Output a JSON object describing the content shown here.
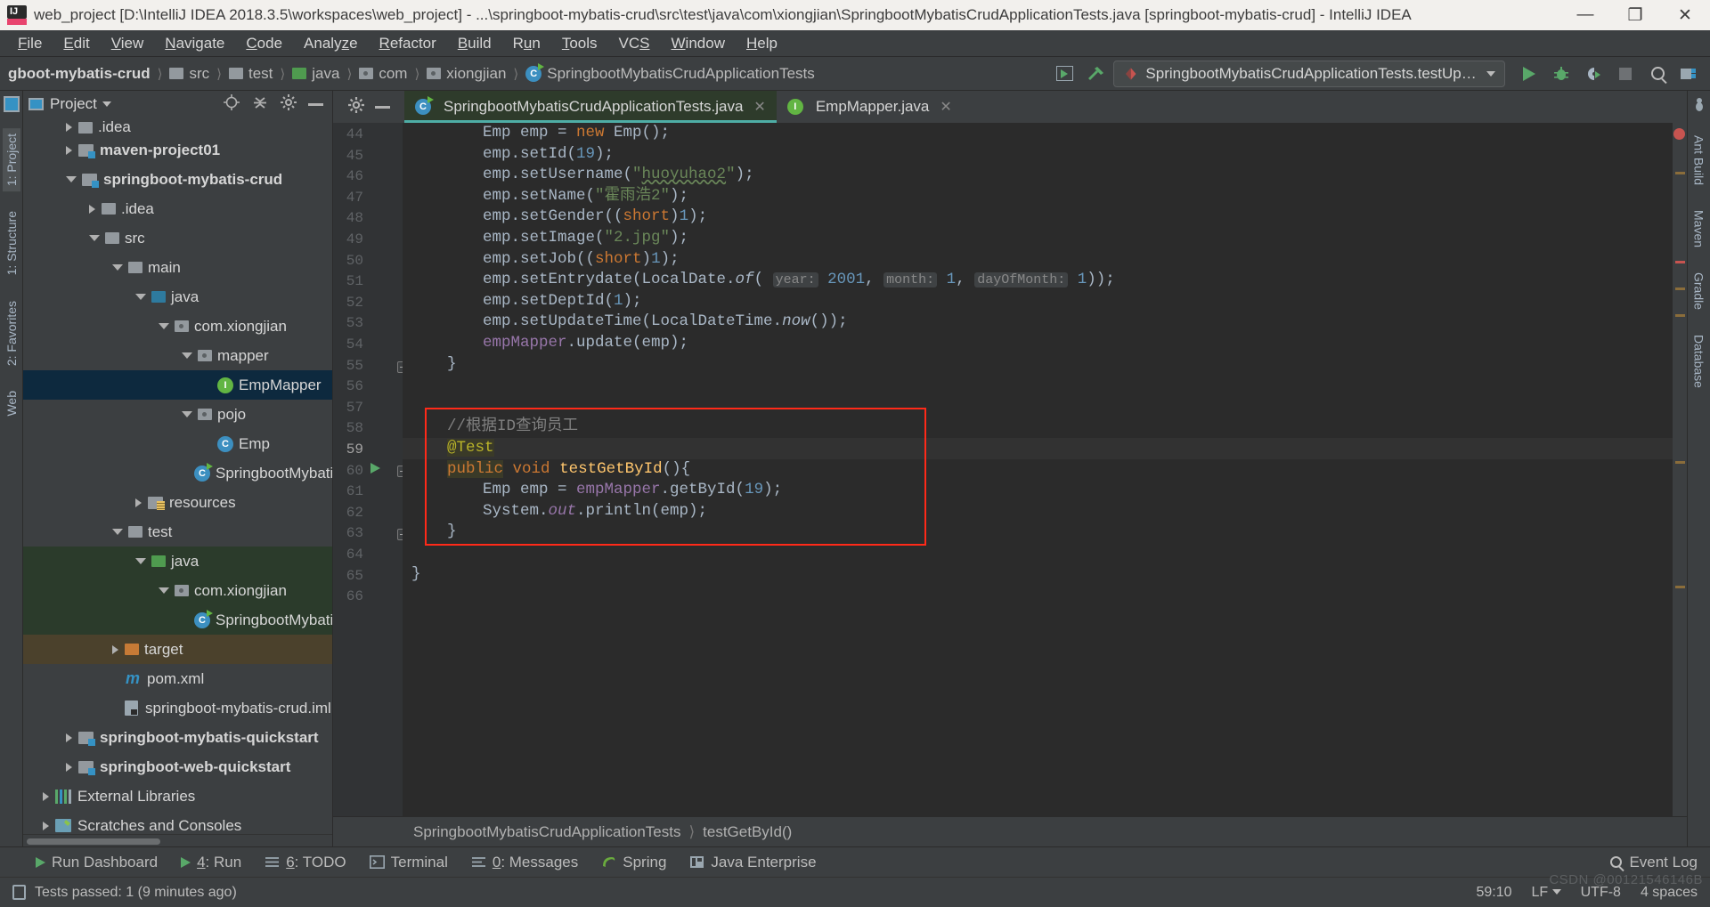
{
  "window": {
    "title": "web_project [D:\\IntelliJ IDEA 2018.3.5\\workspaces\\web_project] - ...\\springboot-mybatis-crud\\src\\test\\java\\com\\xiongjian\\SpringbootMybatisCrudApplicationTests.java [springboot-mybatis-crud] - IntelliJ IDEA",
    "minimize": "—",
    "maximize": "❐",
    "close": "✕"
  },
  "menubar": [
    {
      "label": "File",
      "mnemonic": "F"
    },
    {
      "label": "Edit",
      "mnemonic": "E"
    },
    {
      "label": "View",
      "mnemonic": "V"
    },
    {
      "label": "Navigate",
      "mnemonic": "N"
    },
    {
      "label": "Code",
      "mnemonic": "C"
    },
    {
      "label": "Analyze",
      "mnemonic": "z"
    },
    {
      "label": "Refactor",
      "mnemonic": "R"
    },
    {
      "label": "Build",
      "mnemonic": "B"
    },
    {
      "label": "Run",
      "mnemonic": "u"
    },
    {
      "label": "Tools",
      "mnemonic": "T"
    },
    {
      "label": "VCS",
      "mnemonic": "S"
    },
    {
      "label": "Window",
      "mnemonic": "W"
    },
    {
      "label": "Help",
      "mnemonic": "H"
    }
  ],
  "navbar": {
    "crumbs": [
      {
        "label": "gboot-mybatis-crud",
        "icon": "module-icon"
      },
      {
        "label": "src",
        "icon": "folder-icon"
      },
      {
        "label": "test",
        "icon": "folder-icon"
      },
      {
        "label": "java",
        "icon": "source-folder-icon"
      },
      {
        "label": "com",
        "icon": "package-icon"
      },
      {
        "label": "xiongjian",
        "icon": "package-icon"
      },
      {
        "label": "SpringbootMybatisCrudApplicationTests",
        "icon": "test-class-icon"
      }
    ],
    "run_config": "SpringbootMybatisCrudApplicationTests.testUpdate"
  },
  "project_panel": {
    "title": "Project",
    "tree": [
      {
        "label": ".idea",
        "indent": 1,
        "toggle": "collapsed",
        "icon": "folder-icon",
        "bold": false,
        "state": "clipped"
      },
      {
        "label": "maven-project01",
        "indent": 1,
        "toggle": "collapsed",
        "icon": "module-icon",
        "bold": true
      },
      {
        "label": "springboot-mybatis-crud",
        "indent": 1,
        "toggle": "expanded",
        "icon": "module-icon",
        "bold": true
      },
      {
        "label": ".idea",
        "indent": 2,
        "toggle": "collapsed",
        "icon": "folder-icon",
        "bold": false
      },
      {
        "label": "src",
        "indent": 2,
        "toggle": "expanded",
        "icon": "folder-icon",
        "bold": false
      },
      {
        "label": "main",
        "indent": 3,
        "toggle": "expanded",
        "icon": "folder-icon",
        "bold": false
      },
      {
        "label": "java",
        "indent": 4,
        "toggle": "expanded",
        "icon": "source-folder-icon",
        "bold": false
      },
      {
        "label": "com.xiongjian",
        "indent": 5,
        "toggle": "expanded",
        "icon": "package-icon",
        "bold": false
      },
      {
        "label": "mapper",
        "indent": 6,
        "toggle": "expanded",
        "icon": "package-icon",
        "bold": false
      },
      {
        "label": "EmpMapper",
        "indent": 7,
        "toggle": "none",
        "icon": "interface-icon",
        "bold": false,
        "selected": true
      },
      {
        "label": "pojo",
        "indent": 6,
        "toggle": "expanded",
        "icon": "package-icon",
        "bold": false
      },
      {
        "label": "Emp",
        "indent": 7,
        "toggle": "none",
        "icon": "class-icon",
        "bold": false
      },
      {
        "label": "SpringbootMybatisCruc",
        "indent": 6,
        "toggle": "none",
        "icon": "spring-class-icon",
        "bold": false
      },
      {
        "label": "resources",
        "indent": 4,
        "toggle": "collapsed",
        "icon": "resources-folder-icon",
        "bold": false
      },
      {
        "label": "test",
        "indent": 3,
        "toggle": "expanded",
        "icon": "folder-icon",
        "bold": false
      },
      {
        "label": "java",
        "indent": 4,
        "toggle": "expanded",
        "icon": "test-source-folder-icon",
        "bold": false,
        "row_bg": "test"
      },
      {
        "label": "com.xiongjian",
        "indent": 5,
        "toggle": "expanded",
        "icon": "package-icon",
        "bold": false,
        "row_bg": "test"
      },
      {
        "label": "SpringbootMybatisCruc",
        "indent": 6,
        "toggle": "none",
        "icon": "spring-class-icon",
        "bold": false,
        "row_bg": "test"
      },
      {
        "label": "target",
        "indent": 3,
        "toggle": "collapsed",
        "icon": "excluded-folder-icon",
        "bold": false,
        "row_bg": "target"
      },
      {
        "label": "pom.xml",
        "indent": 3,
        "toggle": "none",
        "icon": "maven-icon",
        "bold": false
      },
      {
        "label": "springboot-mybatis-crud.iml",
        "indent": 3,
        "toggle": "none",
        "icon": "iml-icon",
        "bold": false
      },
      {
        "label": "springboot-mybatis-quickstart",
        "indent": 1,
        "toggle": "collapsed",
        "icon": "module-icon",
        "bold": true
      },
      {
        "label": "springboot-web-quickstart",
        "indent": 1,
        "toggle": "collapsed",
        "icon": "module-icon",
        "bold": true
      },
      {
        "label": "External Libraries",
        "indent": 0,
        "toggle": "collapsed",
        "icon": "libraries-icon",
        "bold": false
      },
      {
        "label": "Scratches and Consoles",
        "indent": 0,
        "toggle": "collapsed",
        "icon": "scratches-icon",
        "bold": false
      }
    ]
  },
  "left_strip": [
    {
      "label": "1: Project",
      "selected": true
    },
    {
      "label": "1: Structure",
      "selected": false
    },
    {
      "label": "2: Favorites",
      "selected": false
    },
    {
      "label": "Web",
      "selected": false
    }
  ],
  "right_strip": [
    {
      "label": "Ant Build"
    },
    {
      "label": "Maven"
    },
    {
      "label": "Gradle"
    },
    {
      "label": "Database"
    }
  ],
  "editor": {
    "tabs": [
      {
        "label": "SpringbootMybatisCrudApplicationTests.java",
        "icon": "spring-test-class-icon",
        "active": true
      },
      {
        "label": "EmpMapper.java",
        "icon": "interface-icon",
        "active": false
      }
    ],
    "first_line_number": 44,
    "lines": [
      {
        "n": 44,
        "text": "        Emp emp = new Emp();"
      },
      {
        "n": 45,
        "text": "        emp.setId(19);"
      },
      {
        "n": 46,
        "text": "        emp.setUsername(\"huoyuhao2\");"
      },
      {
        "n": 47,
        "text": "        emp.setName(\"霍雨浩2\");"
      },
      {
        "n": 48,
        "text": "        emp.setGender((short)1);"
      },
      {
        "n": 49,
        "text": "        emp.setImage(\"2.jpg\");"
      },
      {
        "n": 50,
        "text": "        emp.setJob((short)1);"
      },
      {
        "n": 51,
        "text": "        emp.setEntrydate(LocalDate.of( year: 2001, month: 1, dayOfMonth: 1));"
      },
      {
        "n": 52,
        "text": "        emp.setDeptId(1);"
      },
      {
        "n": 53,
        "text": "        emp.setUpdateTime(LocalDateTime.now());"
      },
      {
        "n": 54,
        "text": "        empMapper.update(emp);"
      },
      {
        "n": 55,
        "text": "    }"
      },
      {
        "n": 56,
        "text": ""
      },
      {
        "n": 57,
        "text": ""
      },
      {
        "n": 58,
        "text": "    //根据ID查询员工"
      },
      {
        "n": 59,
        "text": "    @Test"
      },
      {
        "n": 60,
        "text": "    public void testGetById(){"
      },
      {
        "n": 61,
        "text": "        Emp emp = empMapper.getById(19);"
      },
      {
        "n": 62,
        "text": "        System.out.println(emp);"
      },
      {
        "n": 63,
        "text": "    }"
      },
      {
        "n": 64,
        "text": ""
      },
      {
        "n": 65,
        "text": "}"
      },
      {
        "n": 66,
        "text": ""
      }
    ],
    "breadcrumb": {
      "class": "SpringbootMybatisCrudApplicationTests",
      "method": "testGetById()"
    },
    "highlight_box_label": "red-annotation-box"
  },
  "bottom_toolwindows": [
    {
      "label": "Run Dashboard",
      "icon": "play-icon",
      "mnemonic": ""
    },
    {
      "label": "4: Run",
      "icon": "play-icon",
      "mnemonic": "4"
    },
    {
      "label": "6: TODO",
      "icon": "todo-icon",
      "mnemonic": "6"
    },
    {
      "label": "Terminal",
      "icon": "terminal-icon",
      "mnemonic": ""
    },
    {
      "label": "0: Messages",
      "icon": "messages-icon",
      "mnemonic": "0"
    },
    {
      "label": "Spring",
      "icon": "spring-icon",
      "mnemonic": ""
    },
    {
      "label": "Java Enterprise",
      "icon": "java-enterprise-icon",
      "mnemonic": ""
    }
  ],
  "event_log": "Event Log",
  "statusbar": {
    "message": "Tests passed: 1 (9 minutes ago)",
    "caret": "59:10",
    "line_separator": "LF",
    "encoding": "UTF-8",
    "indent": "4 spaces"
  },
  "watermark": "CSDN @00121546146B",
  "colors": {
    "accent_green": "#59a869",
    "selection_blue": "#0d293e",
    "test_green_bg": "#2b3b2b",
    "target_brown_bg": "#4b412c",
    "red_box": "#ff2a19",
    "editor_bg": "#2b2b2b",
    "panel_bg": "#3c3f41"
  }
}
